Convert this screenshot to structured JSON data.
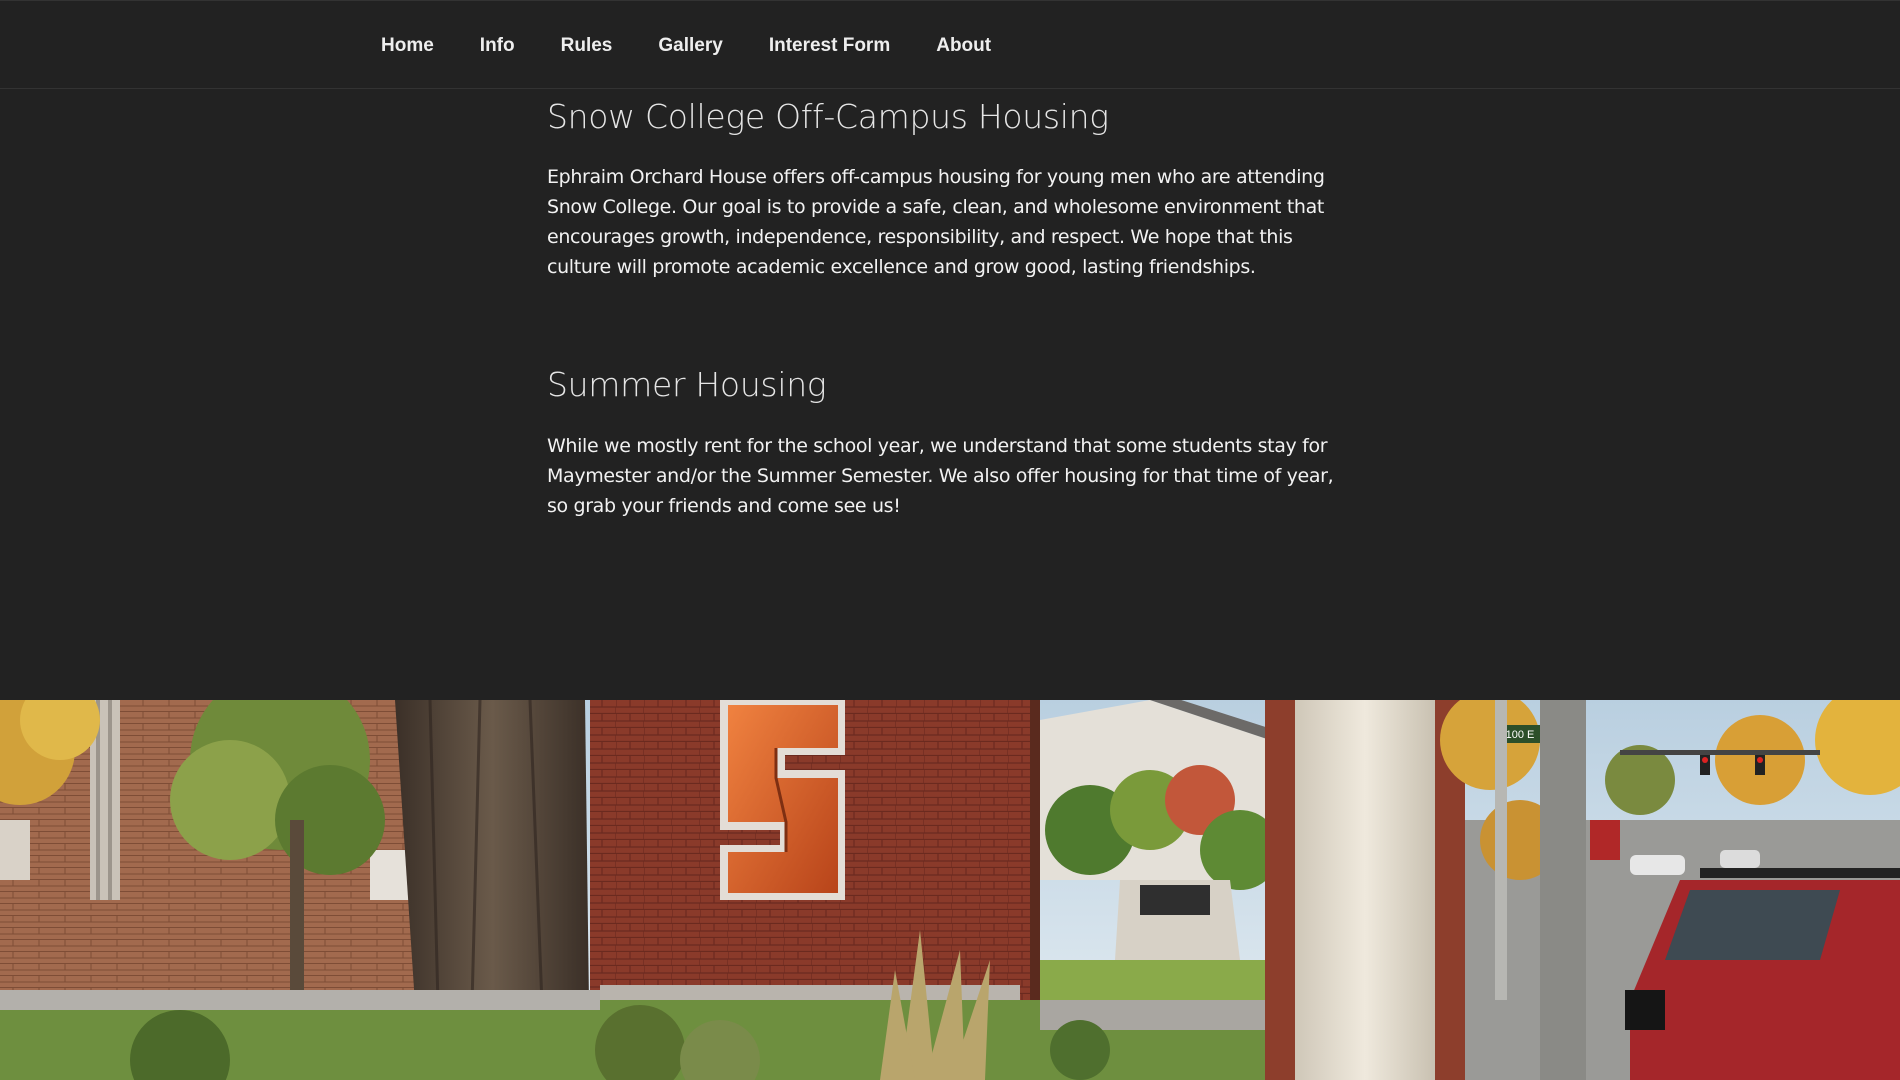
{
  "nav": {
    "items": [
      {
        "label": "Home"
      },
      {
        "label": "Info"
      },
      {
        "label": "Rules"
      },
      {
        "label": "Gallery"
      },
      {
        "label": "Interest Form"
      },
      {
        "label": "About"
      }
    ]
  },
  "sections": [
    {
      "title": "Snow College Off-Campus Housing",
      "body": "Ephraim Orchard House offers off-campus housing for young men who are attending Snow College. Our goal is to provide a safe, clean, and wholesome environment that encourages growth, independence, responsibility, and respect. We hope that this culture will promote academic excellence and grow good, lasting friendships."
    },
    {
      "title": "Summer Housing",
      "body": "While we mostly rent for the school year, we understand that some students stay for Maymester and/or the Summer Semester. We also offer housing for that time of year, so grab your friends and come see us!"
    }
  ],
  "hero": {
    "sign_letter": "S",
    "street_sign": "100 E"
  },
  "colors": {
    "background": "#222222",
    "nav_text": "#eeeeee",
    "heading_text": "#e5e5e5",
    "body_text": "#f2f2f2",
    "brick": "#8e3b2b",
    "sign_orange": "#d3531f"
  }
}
